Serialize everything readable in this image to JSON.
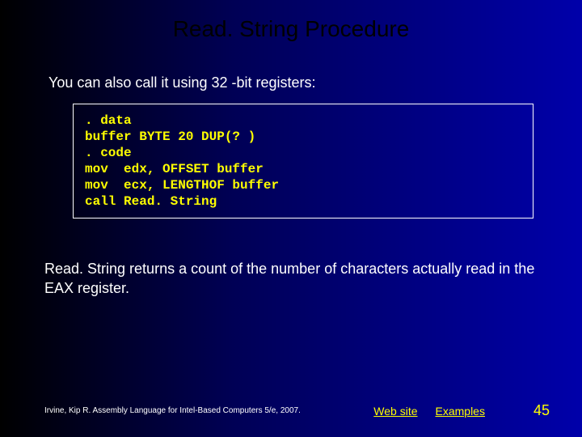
{
  "title": "Read. String Procedure",
  "intro": "You can also call it using 32 -bit registers:",
  "code": ". data\nbuffer BYTE 20 DUP(? )\n. code\nmov  edx, OFFSET buffer\nmov  ecx, LENGTHOF buffer\ncall Read. String",
  "explain": "Read. String returns a count of the number of characters actually read in the EAX register.",
  "footer": {
    "citation": "Irvine, Kip R. Assembly Language for Intel-Based Computers 5/e, 2007.",
    "link_web": "Web site",
    "link_examples": "Examples",
    "page": "45"
  }
}
